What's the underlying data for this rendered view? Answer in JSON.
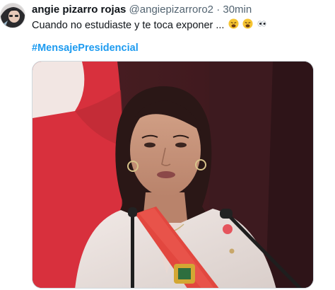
{
  "tweet": {
    "author": {
      "display_name": "angie pizarro rojas",
      "handle": "@angiepizarroro2",
      "separator": "·",
      "timestamp": "30min"
    },
    "text": "Cuando no estudiaste y te toca exponer ...",
    "emojis": [
      "weary-face-emoji",
      "weary-face-emoji",
      "eyes-emoji"
    ],
    "hashtag": "#MensajePresidencial",
    "media": {
      "kind": "photo",
      "subject": "woman speaking at podium with microphones"
    }
  },
  "colors": {
    "name": "#0f1419",
    "secondary": "#536471",
    "link": "#1d9bf0",
    "flag_red": "#d8303d",
    "sash_red": "#e2473f"
  }
}
